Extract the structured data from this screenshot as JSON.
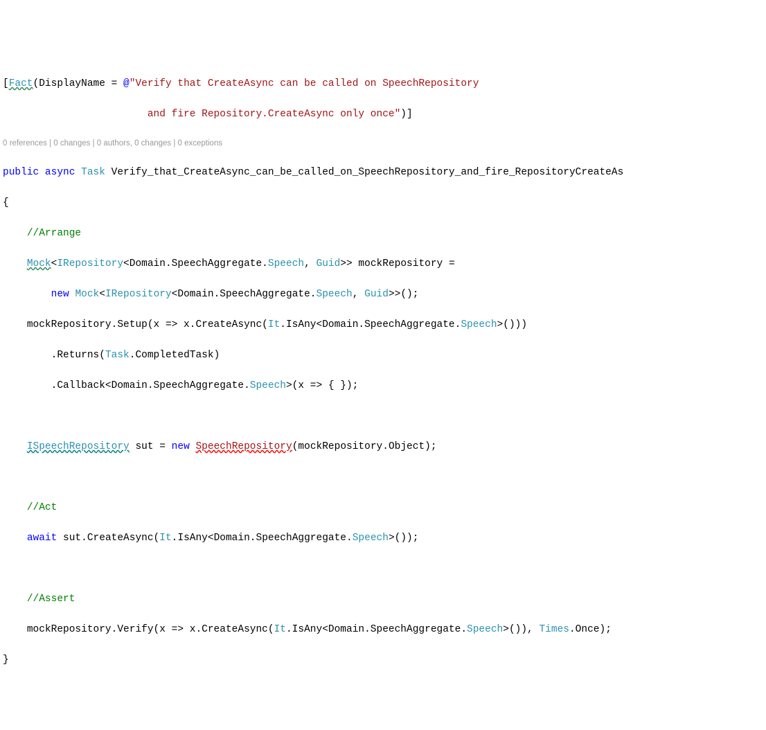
{
  "l1": {
    "fact": "Fact",
    "disp": "(DisplayName = ",
    "at": "@",
    "s1": "\"Verify that CreateAsync can be called on SpeechRepository "
  },
  "l2": {
    "s2": "                        and fire Repository.CreateAsync only once\"",
    "close": ")]"
  },
  "codelens": "0 references | 0 changes | 0 authors, 0 changes | 0 exceptions",
  "l3": {
    "pub": "public",
    "async": "async",
    "task": "Task",
    "name": " Verify_that_CreateAsync_can_be_called_on_SpeechRepository_and_fire_RepositoryCreateAs"
  },
  "brace_open": "{",
  "c_arrange": "//Arrange",
  "l6": {
    "mock": "Mock",
    "irepo": "IRepository",
    "d1": "<Domain.SpeechAggregate.",
    "speech": "Speech",
    "comma": ", ",
    "guid": "Guid",
    "after": ">> mockRepository ="
  },
  "l7": {
    "pre": "        ",
    "new_": "new",
    "mock": "Mock",
    "irepo": "IRepository",
    "d1": "<Domain.SpeechAggregate.",
    "speech": "Speech",
    "comma": ", ",
    "guid": "Guid",
    "after": ">>();"
  },
  "l8": {
    "a": "mockRepository.Setup(x => x.CreateAsync(",
    "it": "It",
    "isany": ".IsAny<Domain.SpeechAggregate.",
    "speech": "Speech",
    "end": ">()))"
  },
  "l9": {
    "a": "    .Returns(",
    "task": "Task",
    "b": ".CompletedTask)"
  },
  "l10": {
    "a": "    .Callback<Domain.SpeechAggregate.",
    "speech": "Speech",
    "b": ">(x => { });"
  },
  "l12": {
    "isr": "ISpeechRepository",
    "sut": " sut = ",
    "new_": "new",
    "sr": "SpeechRepository",
    "end": "(mockRepository.Object);"
  },
  "c_act": "//Act",
  "l15": {
    "await": "await",
    "a": " sut.CreateAsync(",
    "it": "It",
    "b": ".IsAny<Domain.SpeechAggregate.",
    "speech": "Speech",
    "c": ">());"
  },
  "c_assert": "//Assert",
  "l18": {
    "a": "mockRepository.Verify(x => x.CreateAsync(",
    "it": "It",
    "b": ".IsAny<Domain.SpeechAggregate.",
    "speech": "Speech",
    "c": ">()), ",
    "times": "Times",
    "d": ".Once);"
  },
  "brace_close": "}",
  "chart_data": null
}
